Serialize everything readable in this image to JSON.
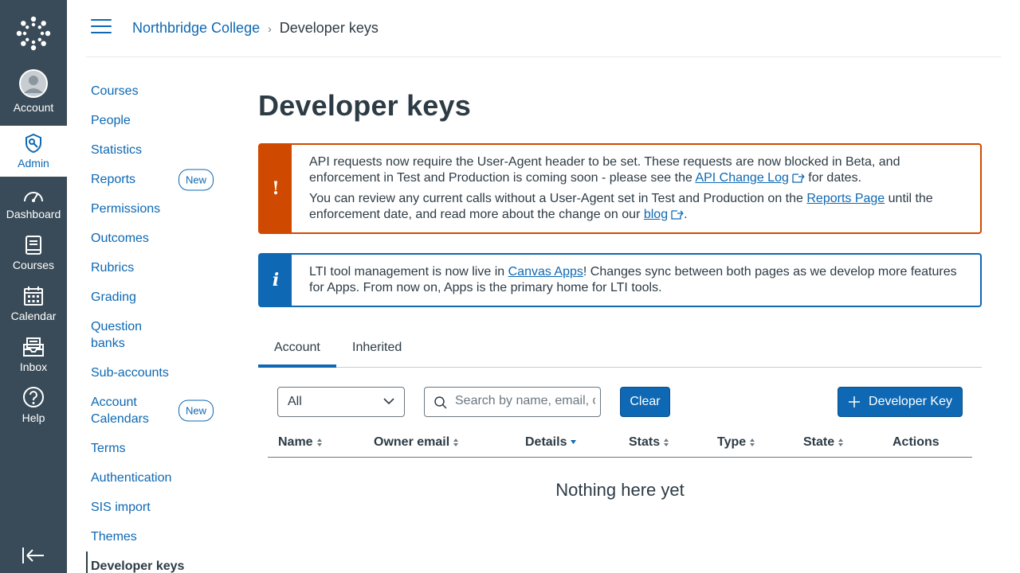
{
  "global_nav": {
    "items": [
      {
        "label": "Account",
        "icon": "account-avatar-icon"
      },
      {
        "label": "Admin",
        "icon": "admin-shield-icon"
      },
      {
        "label": "Dashboard",
        "icon": "dashboard-gauge-icon"
      },
      {
        "label": "Courses",
        "icon": "courses-book-icon"
      },
      {
        "label": "Calendar",
        "icon": "calendar-icon"
      },
      {
        "label": "Inbox",
        "icon": "inbox-icon"
      },
      {
        "label": "Help",
        "icon": "help-icon"
      }
    ],
    "active": "Admin"
  },
  "breadcrumb": {
    "root": "Northbridge College",
    "current": "Developer keys"
  },
  "sidebar": {
    "items": [
      {
        "label": "Courses"
      },
      {
        "label": "People"
      },
      {
        "label": "Statistics"
      },
      {
        "label": "Reports",
        "badge": "New"
      },
      {
        "label": "Permissions"
      },
      {
        "label": "Outcomes"
      },
      {
        "label": "Rubrics"
      },
      {
        "label": "Grading"
      },
      {
        "label": "Question banks"
      },
      {
        "label": "Sub-accounts"
      },
      {
        "label": "Account Calendars",
        "badge": "New"
      },
      {
        "label": "Terms"
      },
      {
        "label": "Authentication"
      },
      {
        "label": "SIS import"
      },
      {
        "label": "Themes"
      },
      {
        "label": "Developer keys",
        "active": true
      }
    ]
  },
  "page": {
    "title": "Developer keys"
  },
  "alerts": {
    "error": {
      "p1_a": "API requests now require the User-Agent header to be set. These requests are now blocked in Beta, and enforcement in Test and Production is coming soon - please see the ",
      "p1_link": "API Change Log",
      "p1_b": " for dates.",
      "p2_a": "You can review any current calls without a User-Agent set in Test and Production on the ",
      "p2_link": "Reports Page",
      "p2_b": " until the enforcement date, and read more about the change on our ",
      "p2_link2": "blog",
      "p2_c": "."
    },
    "info": {
      "a": "LTI tool management is now live in ",
      "link": "Canvas Apps",
      "b": "! Changes sync between both pages as we develop more features for Apps. From now on, Apps is the primary home for LTI tools."
    }
  },
  "tabs": [
    {
      "label": "Account",
      "active": true
    },
    {
      "label": "Inherited"
    }
  ],
  "filters": {
    "select_value": "All",
    "search_placeholder": "Search by name, email, or ID",
    "clear_label": "Clear",
    "add_label": "Developer Key"
  },
  "table": {
    "columns": [
      "Name",
      "Owner email",
      "Details",
      "Stats",
      "Type",
      "State",
      "Actions"
    ],
    "empty_text": "Nothing here yet"
  }
}
